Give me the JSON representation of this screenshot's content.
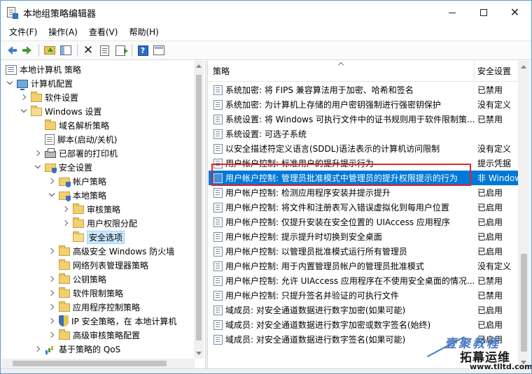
{
  "window": {
    "title": "本地组策略编辑器"
  },
  "menu": [
    "文件(F)",
    "操作(A)",
    "查看(V)",
    "帮助(H)"
  ],
  "toolbar": [
    "back-icon",
    "forward-icon",
    "up-folder-icon",
    "show-hide-tree-icon",
    "delete-icon",
    "properties-icon",
    "export-icon",
    "help-icon",
    "view-icon"
  ],
  "tree": [
    {
      "label": "本地计算机 策略",
      "depth": 0,
      "icon": "policy-icon",
      "expander": "none"
    },
    {
      "label": "计算机配置",
      "depth": 1,
      "icon": "computer-icon",
      "expander": "down"
    },
    {
      "label": "软件设置",
      "depth": 2,
      "icon": "folder-icon",
      "expander": "right"
    },
    {
      "label": "Windows 设置",
      "depth": 2,
      "icon": "folder-icon",
      "expander": "down"
    },
    {
      "label": "域名解析策略",
      "depth": 3,
      "icon": "folder-icon",
      "expander": "none"
    },
    {
      "label": "脚本(启动/关机)",
      "depth": 3,
      "icon": "script-icon",
      "expander": "none"
    },
    {
      "label": "已部署的打印机",
      "depth": 3,
      "icon": "printer-icon",
      "expander": "right"
    },
    {
      "label": "安全设置",
      "depth": 3,
      "icon": "shield-folder-icon",
      "expander": "down"
    },
    {
      "label": "帐户策略",
      "depth": 4,
      "icon": "shield-folder-icon",
      "expander": "right"
    },
    {
      "label": "本地策略",
      "depth": 4,
      "icon": "shield-folder-icon",
      "expander": "down"
    },
    {
      "label": "审核策略",
      "depth": 5,
      "icon": "folder-icon",
      "expander": "right"
    },
    {
      "label": "用户权限分配",
      "depth": 5,
      "icon": "folder-icon",
      "expander": "right"
    },
    {
      "label": "安全选项",
      "depth": 5,
      "icon": "folder-open-icon",
      "expander": "none",
      "selected": true
    },
    {
      "label": "高级安全 Windows 防火墙",
      "depth": 4,
      "icon": "folder-icon",
      "expander": "right"
    },
    {
      "label": "网络列表管理器策略",
      "depth": 4,
      "icon": "folder-icon",
      "expander": "none"
    },
    {
      "label": "公钥策略",
      "depth": 4,
      "icon": "folder-icon",
      "expander": "right"
    },
    {
      "label": "软件限制策略",
      "depth": 4,
      "icon": "folder-icon",
      "expander": "right"
    },
    {
      "label": "应用程序控制策略",
      "depth": 4,
      "icon": "folder-icon",
      "expander": "right"
    },
    {
      "label": "IP 安全策略，在 本地计算机",
      "depth": 4,
      "icon": "shield-icon",
      "expander": "right"
    },
    {
      "label": "高级审核策略配置",
      "depth": 4,
      "icon": "folder-icon",
      "expander": "right"
    },
    {
      "label": "基于策略的 QoS",
      "depth": 3,
      "icon": "chart-icon",
      "expander": "right"
    }
  ],
  "list": {
    "columns": {
      "policy": "策略",
      "setting": "安全设置"
    },
    "rows": [
      {
        "policy": "系统加密: 将 FIPS 兼容算法用于加密、哈希和签名",
        "setting": "已禁用"
      },
      {
        "policy": "系统加密: 为计算机上存储的用户密钥强制进行强密钥保护",
        "setting": "没有定义"
      },
      {
        "policy": "系统设置: 将 Windows 可执行文件中的证书规则用于软件限制策...",
        "setting": "已禁用"
      },
      {
        "policy": "系统设置: 可选子系统",
        "setting": ""
      },
      {
        "policy": "以安全描述符定义语言(SDDL)语法表示的计算机访问限制",
        "setting": "没有定义"
      },
      {
        "policy": "用户帐户控制: 标准用户的提升提示行为",
        "setting": "提示凭据"
      },
      {
        "policy": "用户帐户控制: 管理员批准模式中管理员的提升权限提示的行为",
        "setting": "非 Windows",
        "selected": true
      },
      {
        "policy": "用户帐户控制: 检测应用程序安装并提示提升",
        "setting": "已启用"
      },
      {
        "policy": "用户帐户控制: 将文件和注册表写入错误虚拟化到每用户位置",
        "setting": "已启用"
      },
      {
        "policy": "用户帐户控制: 仅提升安装在安全位置的 UIAccess 应用程序",
        "setting": "已启用"
      },
      {
        "policy": "用户帐户控制: 提示提升时切换到安全桌面",
        "setting": "已启用"
      },
      {
        "policy": "用户帐户控制: 以管理员批准模式运行所有管理员",
        "setting": "已启用"
      },
      {
        "policy": "用户帐户控制: 用于内置管理员帐户的管理员批准模式",
        "setting": "没有定义"
      },
      {
        "policy": "用户帐户控制: 允许 UIAccess 应用程序在不使用安全桌面的情况...",
        "setting": "已禁用"
      },
      {
        "policy": "用户帐户控制: 只提升签名并验证的可执行文件",
        "setting": "已禁用"
      },
      {
        "policy": "域成员: 对安全通道数据进行数字加密(如果可能)",
        "setting": "已启用"
      },
      {
        "policy": "域成员: 对安全通道数据进行数字加密或数字签名(始终)",
        "setting": "已启用"
      },
      {
        "policy": "域成员: 对安全通道数据进行数字签名(如果可能)",
        "setting": "已启用"
      }
    ]
  },
  "watermark": {
    "line1": "壹聚教程",
    "line2": "拓幕运维",
    "line3": "www.tlltd.com"
  },
  "colors": {
    "selection": "#0078d7",
    "highlight": "#e02424",
    "accent": "#5a9bd5"
  }
}
